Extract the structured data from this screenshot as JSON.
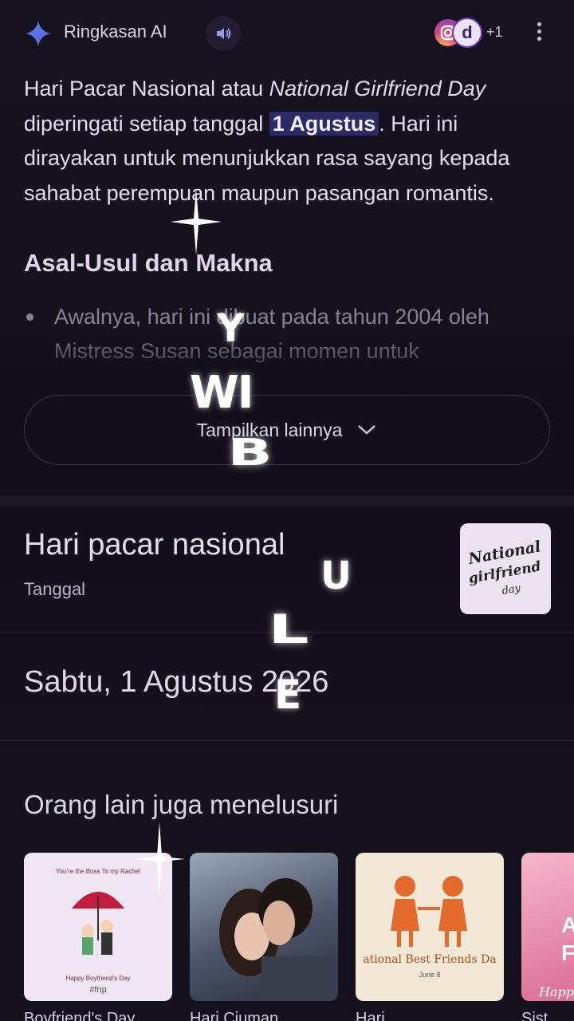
{
  "header": {
    "title": "Ringkasan AI",
    "more_sources": "+1",
    "source_badge_letter": "d"
  },
  "summary": {
    "p1_a": "Hari Pacar Nasional atau ",
    "p1_em": "National Girlfriend Day",
    "p1_b": " diperingati setiap tanggal ",
    "p1_highlight": "1 Agustus",
    "p1_c": ". Hari ini dirayakan untuk menunjukkan rasa sayang kepada sahabat perempuan maupun pasangan romantis."
  },
  "section": {
    "title": "Asal-Usul dan Makna",
    "bullet": "Awalnya, hari ini dibuat pada tahun 2004 oleh Mistress Susan sebagai momen untuk"
  },
  "more_button": {
    "label": "Tampilkan lainnya"
  },
  "knowledge_panel": {
    "title": "Hari pacar nasional",
    "subtitle": "Tanggal",
    "thumb_text": "National girlfriend day",
    "date": "Sabtu, 1 Agustus 2026"
  },
  "others": {
    "title": "Orang lain juga menelusuri",
    "cards": [
      {
        "caption_top": "You're the Boss To my Rachel",
        "caption_bottom": "Happy Boyfriend's Day",
        "tag": "#fnp",
        "label": "Boyfriend's Day"
      },
      {
        "label": "Hari Ciuman"
      },
      {
        "caption": "ational Best Friends Da",
        "sub": "June 8",
        "label": "Hari"
      },
      {
        "caption": "A F",
        "sub": "Happy",
        "label": "Sist"
      }
    ]
  },
  "overlay": {
    "y": "Y",
    "wi": "WI",
    "b": "B",
    "u": "U",
    "l": "L",
    "l2": "L",
    "e": "E"
  },
  "colors": {
    "background": "#15101d",
    "accent_highlight": "#2b2a66",
    "gemini_spark": "#5b7cf0"
  }
}
